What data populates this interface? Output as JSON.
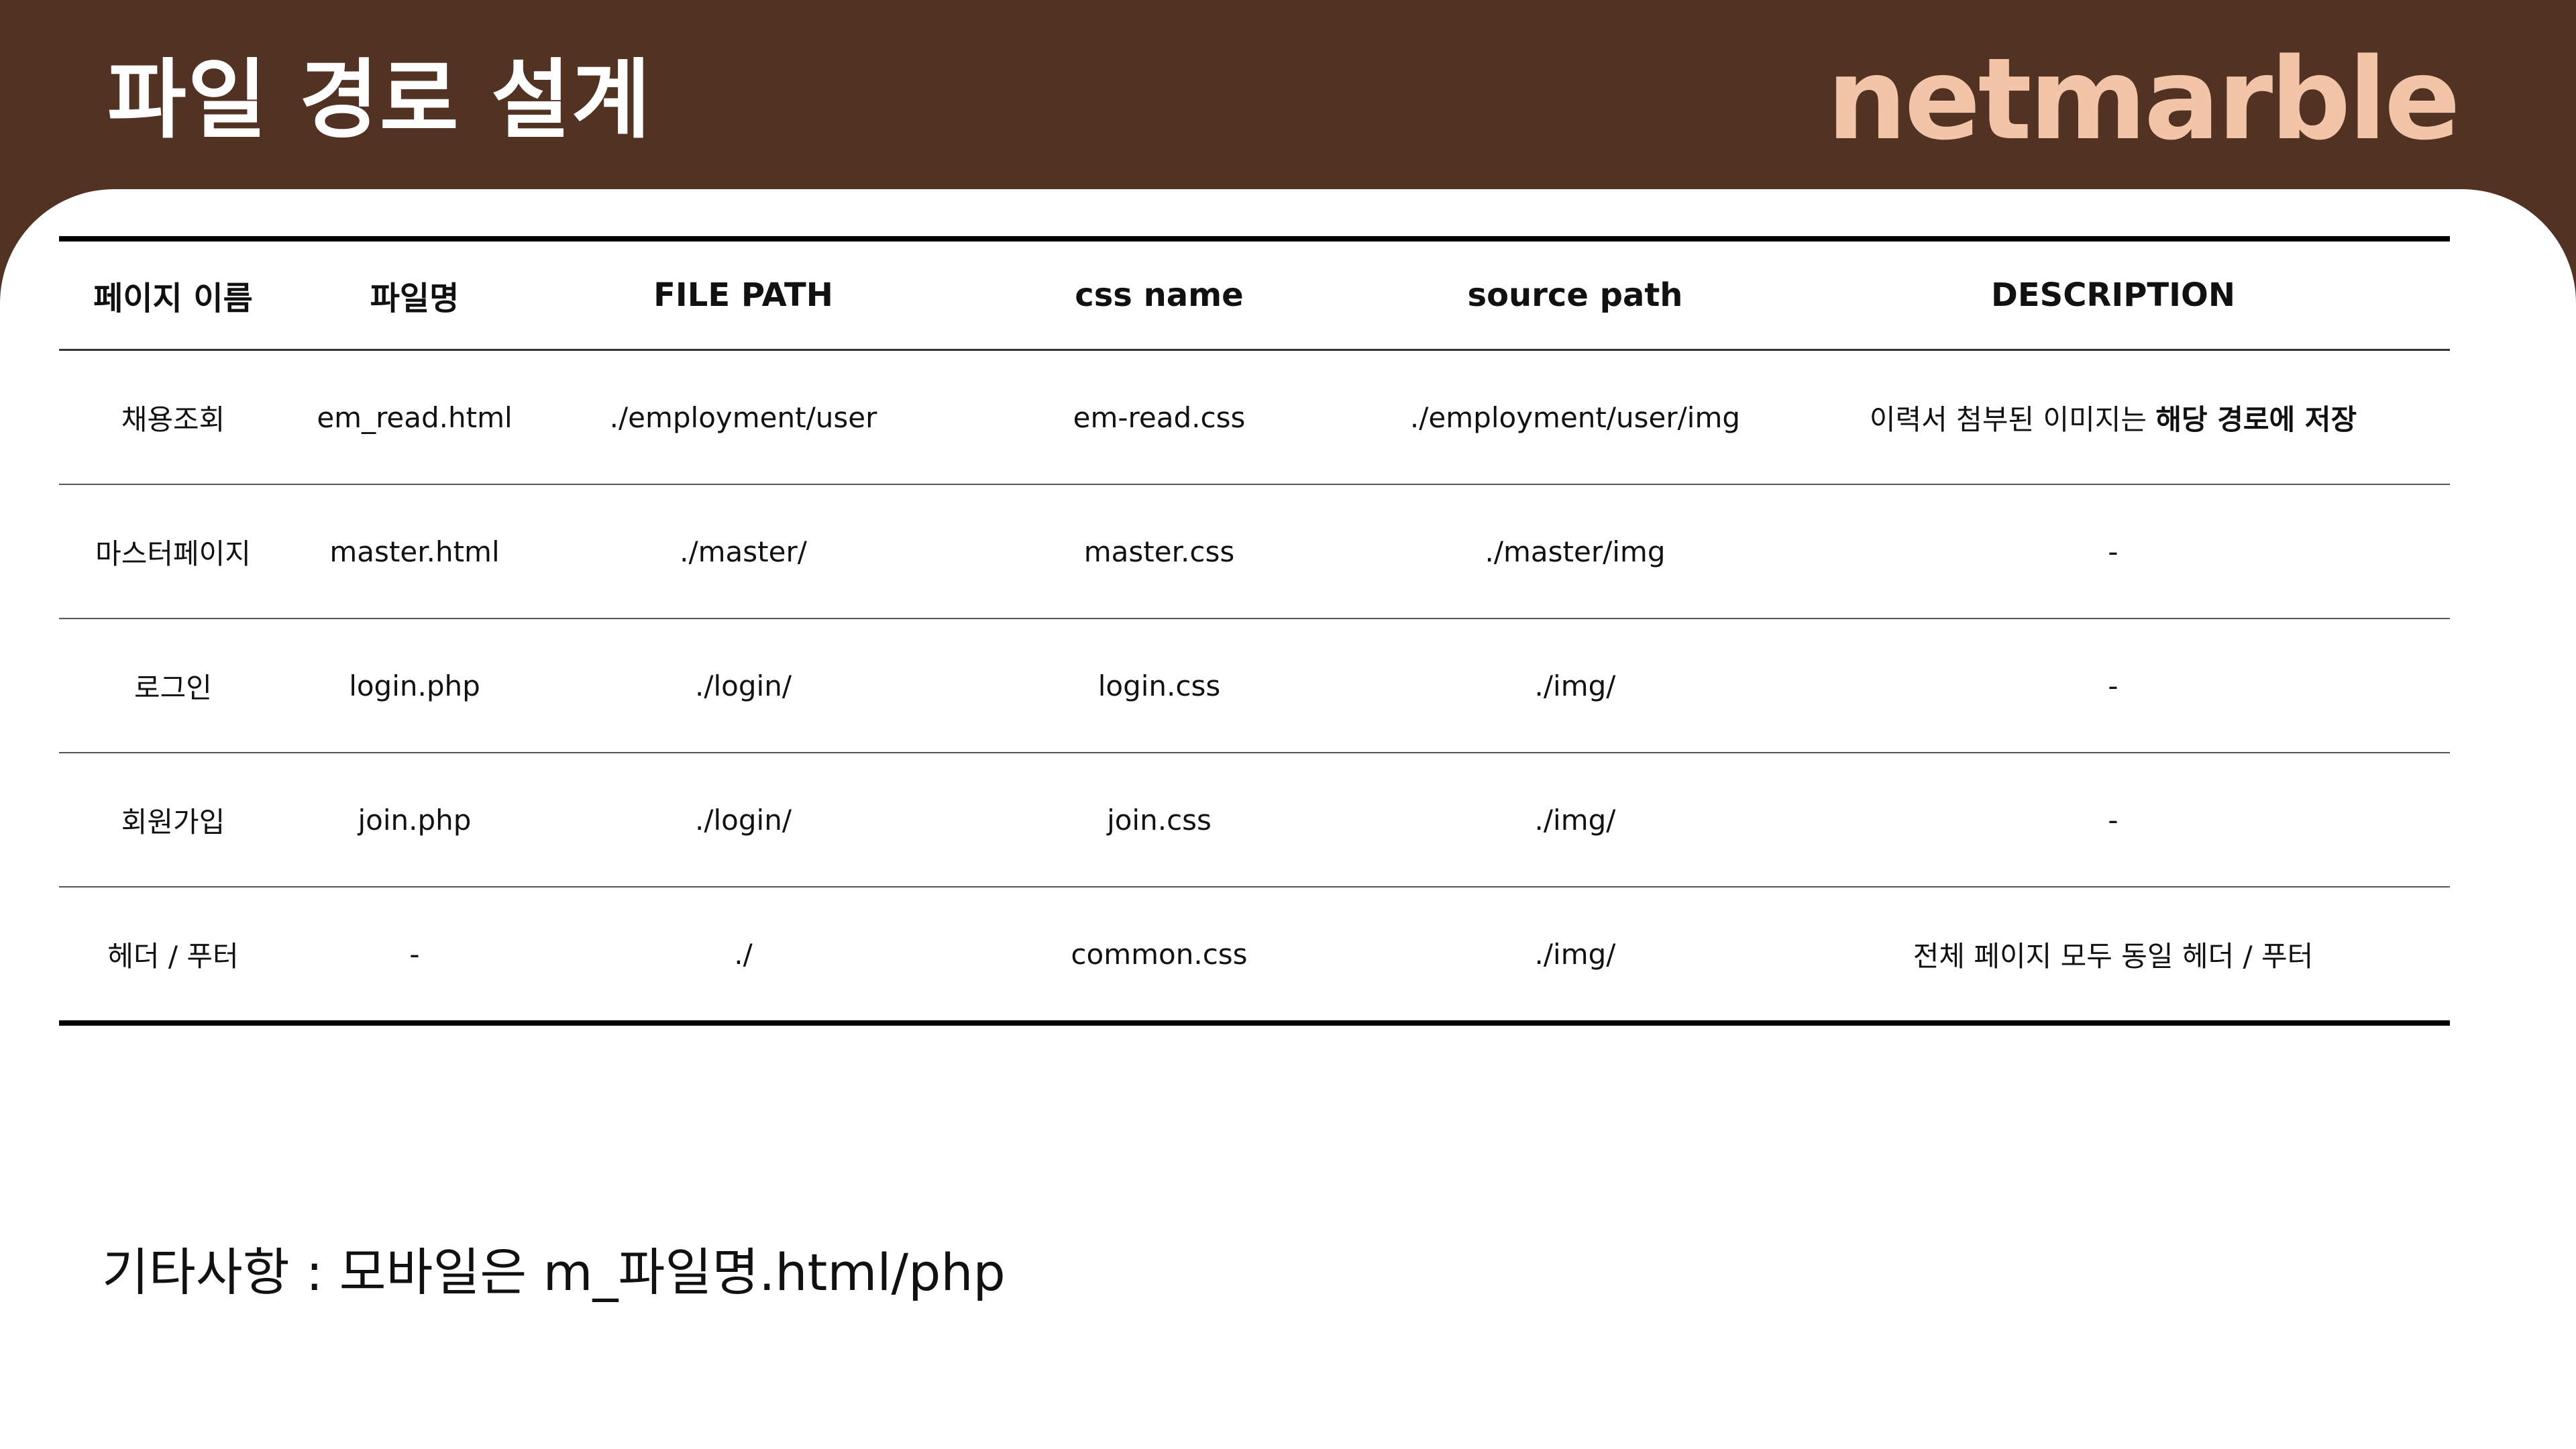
{
  "header": {
    "title": "파일 경로 설계",
    "logo_text": "netmarble",
    "background_color": "#513223",
    "logo_color": "#f2c4a8"
  },
  "table": {
    "columns": [
      "페이지 이름",
      "파일명",
      "FILE PATH",
      "css name",
      "source path",
      "DESCRIPTION"
    ],
    "rows": [
      {
        "page_name": "채용조회",
        "file_name": "em_read.html",
        "file_path": "./employment/user",
        "css_name": "em-read.css",
        "source_path": "./employment/user/img",
        "description": "이력서 첨부된 이미지는 ",
        "description_bold": "해당 경로에 저장"
      },
      {
        "page_name": "마스터페이지",
        "file_name": "master.html",
        "file_path": "./master/",
        "css_name": "master.css",
        "source_path": "./master/img",
        "description": "-",
        "description_bold": ""
      },
      {
        "page_name": "로그인",
        "file_name": "login.php",
        "file_path": "./login/",
        "css_name": "login.css",
        "source_path": "./img/",
        "description": "-",
        "description_bold": ""
      },
      {
        "page_name": "회원가입",
        "file_name": "join.php",
        "file_path": "./login/",
        "css_name": "join.css",
        "source_path": "./img/",
        "description": "-",
        "description_bold": ""
      },
      {
        "page_name": "헤더 / 푸터",
        "file_name": "-",
        "file_path": "./",
        "css_name": "common.css",
        "source_path": "./img/",
        "description": "전체 페이지 모두 동일 헤더 / 푸터",
        "description_bold": ""
      }
    ]
  },
  "footnote": "기타사항 : 모바일은 m_파일명.html/php"
}
